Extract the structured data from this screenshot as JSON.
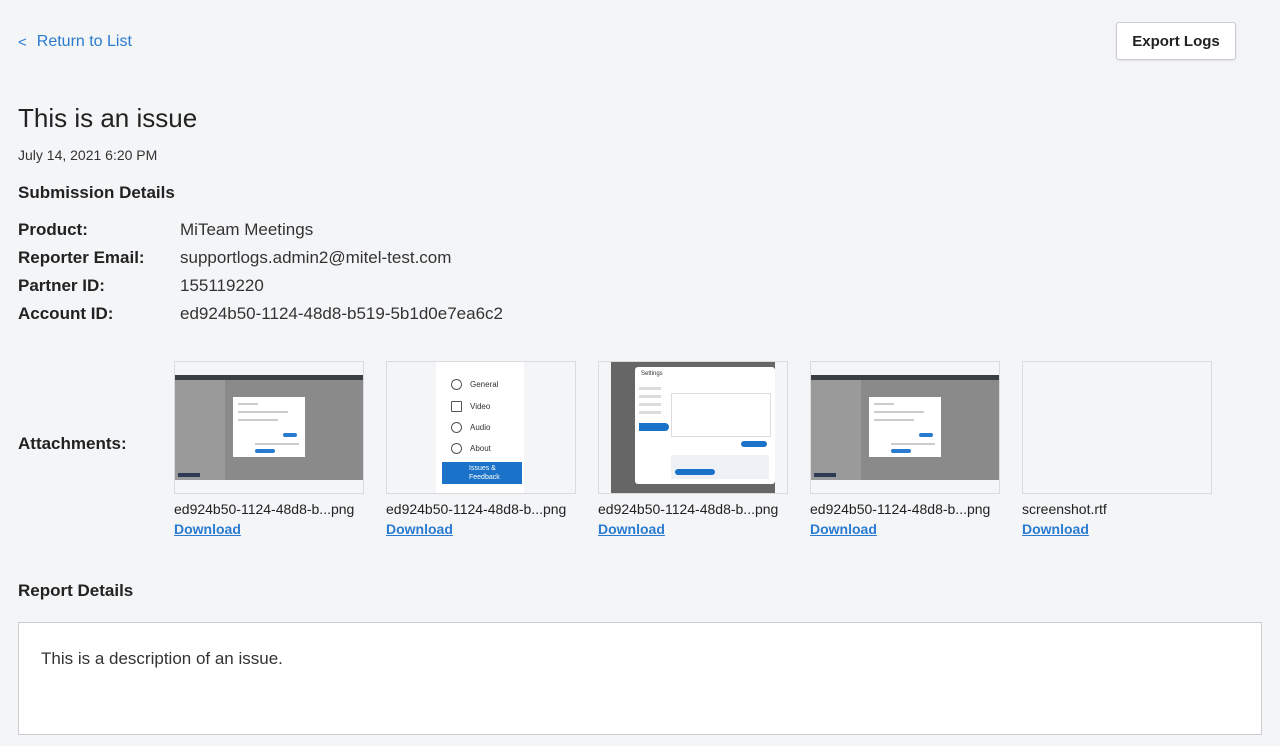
{
  "nav": {
    "back_chevron": "<",
    "back_label": "Return to List"
  },
  "toolbar": {
    "export_label": "Export Logs"
  },
  "issue": {
    "title": "This is an issue",
    "date": "July 14, 2021 6:20 PM"
  },
  "submission": {
    "heading": "Submission Details",
    "rows": [
      {
        "label": "Product:",
        "value": "MiTeam Meetings"
      },
      {
        "label": "Reporter Email:",
        "value": "supportlogs.admin2@mitel-test.com"
      },
      {
        "label": "Partner ID:",
        "value": "155119220"
      },
      {
        "label": "Account ID:",
        "value": "ed924b50-1124-48d8-b519-5b1d0e7ea6c2"
      }
    ]
  },
  "attachments": {
    "label": "Attachments:",
    "download_label": "Download",
    "items": [
      {
        "name": "ed924b50-1124-48d8-b...png"
      },
      {
        "name": "ed924b50-1124-48d8-b...png"
      },
      {
        "name": "ed924b50-1124-48d8-b...png"
      },
      {
        "name": "ed924b50-1124-48d8-b...png"
      },
      {
        "name": "screenshot.rtf"
      }
    ],
    "thumb2_menu": [
      "General",
      "Video",
      "Audio",
      "About"
    ],
    "thumb2_active": "Issues & Feedback",
    "thumb3_title": "Settings"
  },
  "report": {
    "heading": "Report Details",
    "description": "This is a description of an issue."
  },
  "colors": {
    "accent": "#2a7bd0",
    "background": "#f4f5f7"
  }
}
